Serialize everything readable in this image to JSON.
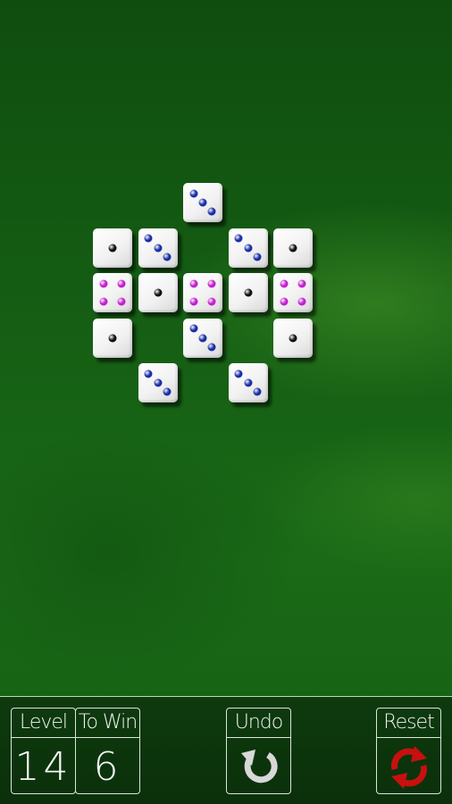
{
  "toolbar": {
    "level_label": "Level",
    "level_value": "14",
    "towin_label": "To Win",
    "towin_value": "6",
    "undo_label": "Undo",
    "reset_label": "Reset",
    "undo_icon": "undo-arrow-icon",
    "reset_icon": "reset-arrows-icon"
  },
  "colors": {
    "pip_one": "#111111",
    "pip_three": "#1a2ea8",
    "pip_four": "#c41ecf",
    "reset_icon": "#c81010",
    "undo_icon": "#d8d8d8"
  },
  "board": {
    "dice": [
      {
        "row": 0,
        "col": 2,
        "value": 3
      },
      {
        "row": 1,
        "col": 0,
        "value": 1
      },
      {
        "row": 1,
        "col": 1,
        "value": 3
      },
      {
        "row": 1,
        "col": 3,
        "value": 3
      },
      {
        "row": 1,
        "col": 4,
        "value": 1
      },
      {
        "row": 2,
        "col": 0,
        "value": 4
      },
      {
        "row": 2,
        "col": 1,
        "value": 1
      },
      {
        "row": 2,
        "col": 2,
        "value": 4
      },
      {
        "row": 2,
        "col": 3,
        "value": 1
      },
      {
        "row": 2,
        "col": 4,
        "value": 4
      },
      {
        "row": 3,
        "col": 0,
        "value": 1
      },
      {
        "row": 3,
        "col": 2,
        "value": 3
      },
      {
        "row": 3,
        "col": 4,
        "value": 1
      },
      {
        "row": 4,
        "col": 1,
        "value": 3
      },
      {
        "row": 4,
        "col": 3,
        "value": 3
      }
    ]
  }
}
